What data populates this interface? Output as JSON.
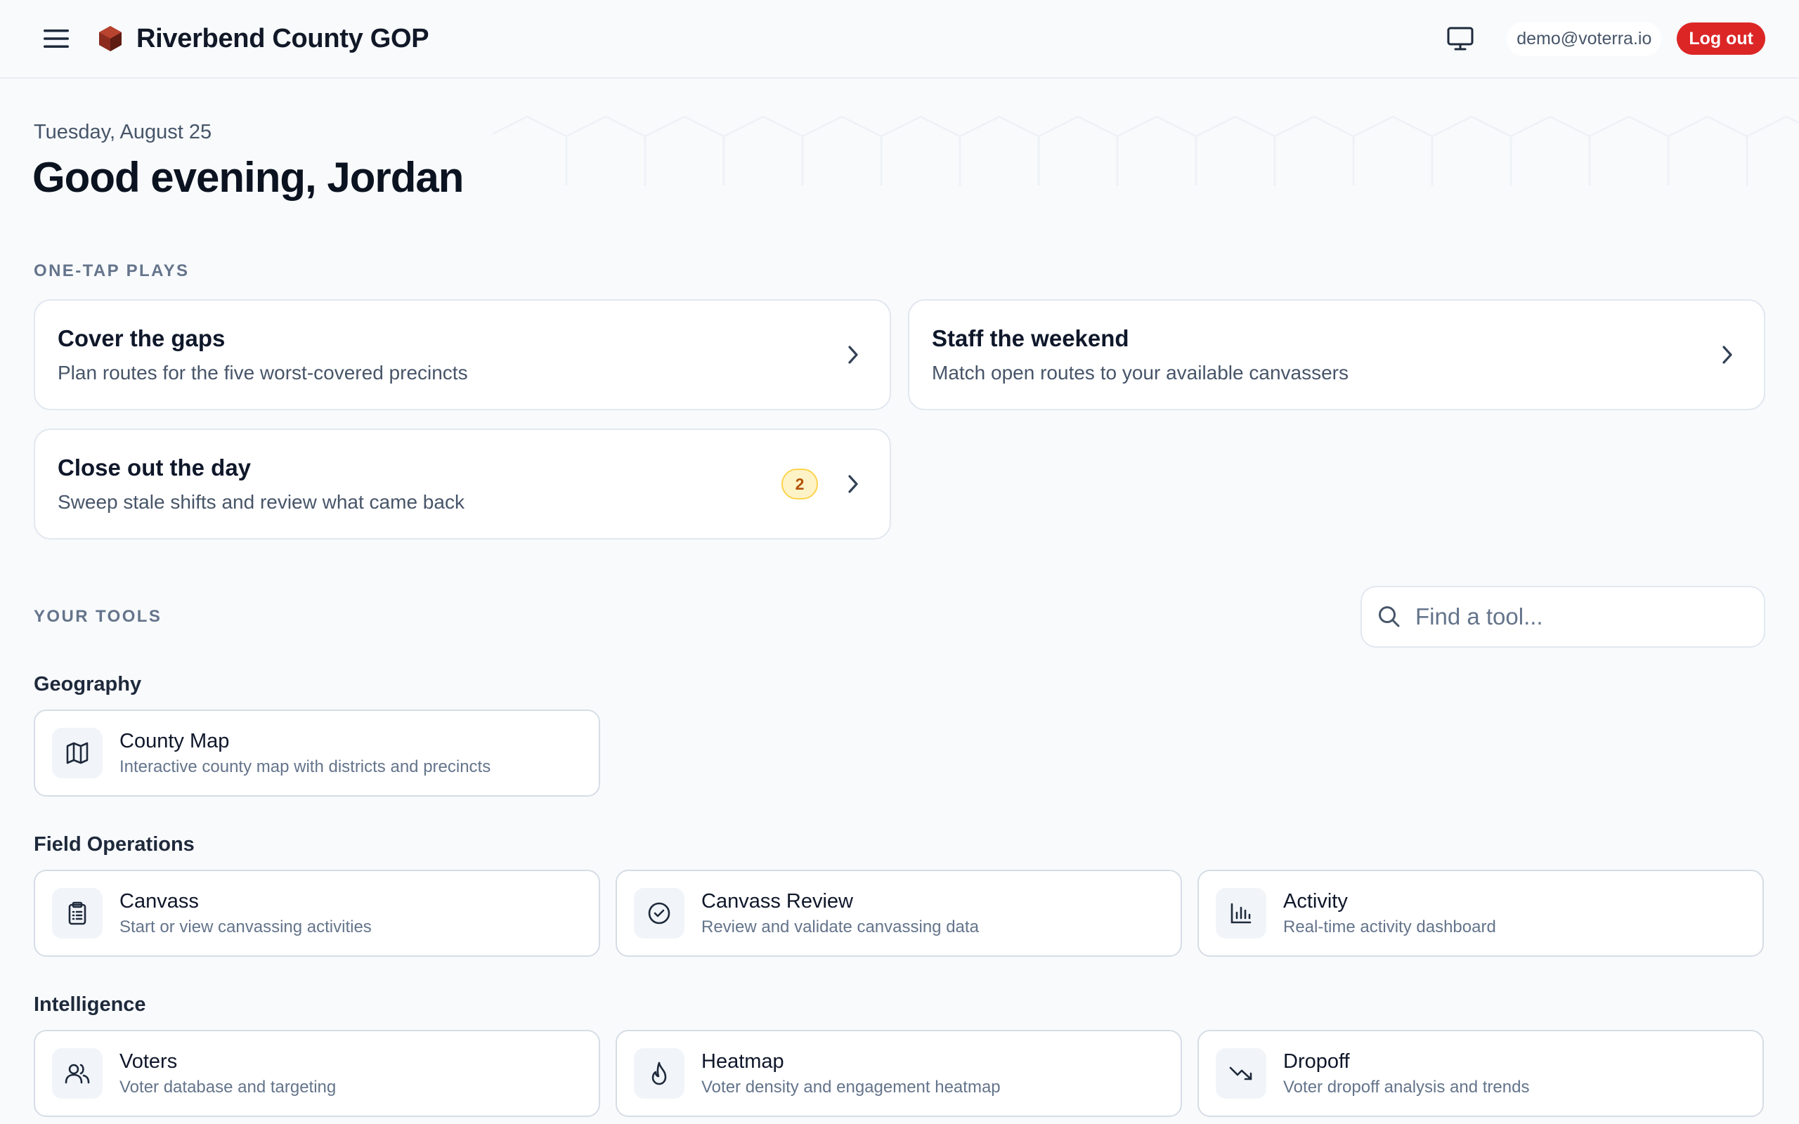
{
  "header": {
    "brand_title": "Riverbend County GOP",
    "user_email": "demo@voterra.io",
    "logout_label": "Log out",
    "icons": {
      "menu": "hamburger-icon",
      "logo": "hexagon-logo",
      "display": "monitor-icon"
    },
    "colors": {
      "logout": "#dc2626",
      "logo": "#8b2c1f"
    }
  },
  "greeting": {
    "date": "Tuesday, August 25",
    "message": "Good evening, Jordan"
  },
  "plays": {
    "section_label": "ONE-TAP PLAYS",
    "items": [
      {
        "title": "Cover the gaps",
        "subtitle": "Plan routes for the five worst-covered precincts"
      },
      {
        "title": "Staff the weekend",
        "subtitle": "Match open routes to your available canvassers"
      },
      {
        "title": "Close out the day",
        "subtitle": "Sweep stale shifts and review what came back",
        "badge": "2"
      }
    ]
  },
  "tools": {
    "section_label": "YOUR TOOLS",
    "search_placeholder": "Find a tool...",
    "groups": [
      {
        "title": "Geography",
        "items": [
          {
            "name": "County Map",
            "description": "Interactive county map with districts and precincts",
            "icon": "map-icon"
          }
        ]
      },
      {
        "title": "Field Operations",
        "items": [
          {
            "name": "Canvass",
            "description": "Start or view canvassing activities",
            "icon": "clipboard-icon"
          },
          {
            "name": "Canvass Review",
            "description": "Review and validate canvassing data",
            "icon": "check-circle-icon"
          },
          {
            "name": "Activity",
            "description": "Real-time activity dashboard",
            "icon": "bar-chart-icon"
          }
        ]
      },
      {
        "title": "Intelligence",
        "items": [
          {
            "name": "Voters",
            "description": "Voter database and targeting",
            "icon": "users-icon"
          },
          {
            "name": "Heatmap",
            "description": "Voter density and engagement heatmap",
            "icon": "flame-icon"
          },
          {
            "name": "Dropoff",
            "description": "Voter dropoff analysis and trends",
            "icon": "trending-down-icon"
          }
        ]
      }
    ]
  }
}
